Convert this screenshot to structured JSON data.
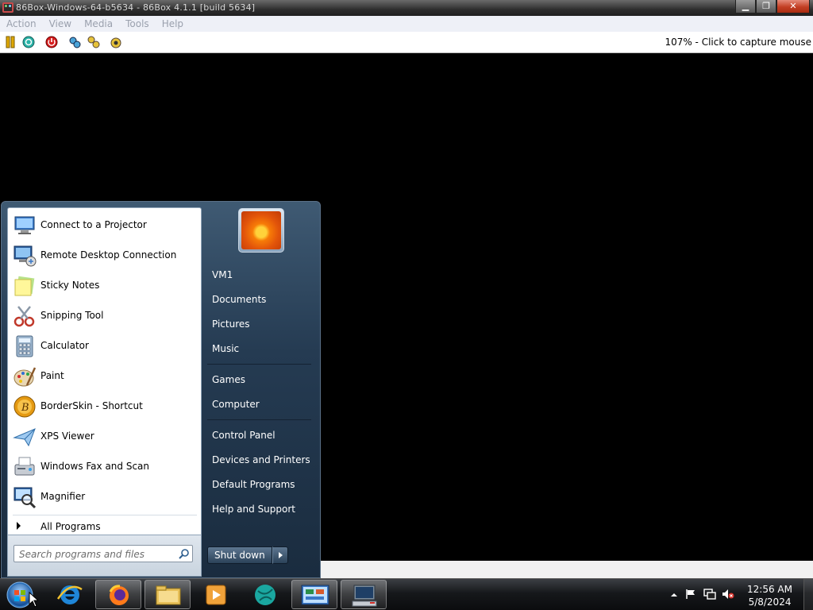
{
  "window": {
    "title": "86Box-Windows-64-b5634 - 86Box 4.1.1 [build 5634]",
    "minimize_icon": "minimize-icon",
    "restore_icon": "restore-icon",
    "close_icon": "close-icon"
  },
  "menubar": {
    "items": [
      "Action",
      "View",
      "Media",
      "Tools",
      "Help"
    ]
  },
  "toolbar": {
    "icons": [
      "pause-icon",
      "reset-icon",
      "power-icon",
      "settings-icon",
      "cad-icon",
      "machine-icon"
    ],
    "status": "107% - Click to capture mouse"
  },
  "start_menu": {
    "programs": [
      {
        "label": "Connect to a Projector",
        "icon": "projector-icon"
      },
      {
        "label": "Remote Desktop Connection",
        "icon": "remote-desktop-icon"
      },
      {
        "label": "Sticky Notes",
        "icon": "sticky-notes-icon"
      },
      {
        "label": "Snipping Tool",
        "icon": "scissors-icon"
      },
      {
        "label": "Calculator",
        "icon": "calculator-icon"
      },
      {
        "label": "Paint",
        "icon": "palette-icon"
      },
      {
        "label": "BorderSkin - Shortcut",
        "icon": "borderskin-icon"
      },
      {
        "label": "XPS Viewer",
        "icon": "paper-plane-icon"
      },
      {
        "label": "Windows Fax and Scan",
        "icon": "fax-icon"
      },
      {
        "label": "Magnifier",
        "icon": "magnifier-icon"
      }
    ],
    "all_programs": "All Programs",
    "search_placeholder": "Search programs and files",
    "right_links": {
      "user": "VM1",
      "documents": "Documents",
      "pictures": "Pictures",
      "music": "Music",
      "games": "Games",
      "computer": "Computer",
      "control_panel": "Control Panel",
      "devices": "Devices and Printers",
      "default_programs": "Default Programs",
      "help": "Help and Support"
    },
    "shutdown_label": "Shut down"
  },
  "taskbar": {
    "items": [
      "start-orb-icon",
      "internet-explorer-icon",
      "firefox-icon",
      "file-explorer-icon",
      "media-player-icon",
      "browser-globe-icon",
      "control-panel-icon",
      "computer-icon"
    ],
    "tray_icons": [
      "show-hidden-icons-chevron",
      "action-center-flag-icon",
      "network-icon",
      "volume-muted-icon"
    ],
    "time": "12:56 AM",
    "date": "5/8/2024"
  },
  "colors": {
    "accent_start_menu": "#253b52",
    "menu_disabled_text": "#9aa0ad"
  }
}
